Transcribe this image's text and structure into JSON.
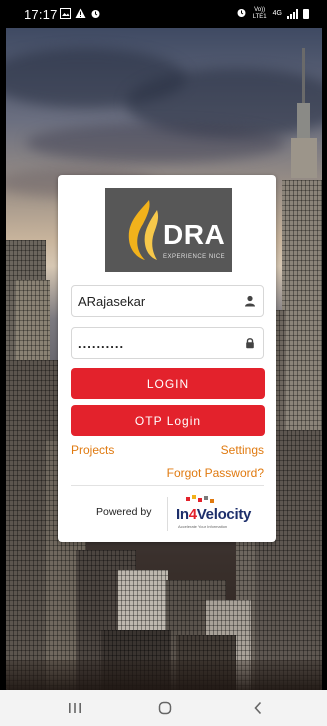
{
  "status_bar": {
    "time": "17:17",
    "left_icons": [
      "gallery-icon",
      "warning-icon",
      "alarm-icon"
    ],
    "right_icons": [
      "alarm-icon",
      "volte-icon",
      "4g-icon",
      "signal-icon",
      "battery-icon"
    ],
    "volte_label": "Vo)) LTE1",
    "network_label": "4G"
  },
  "card": {
    "logo": {
      "brand": "DRA",
      "tagline": "EXPERIENCE NICE"
    },
    "username": {
      "value": "ARajasekar",
      "icon": "user-icon"
    },
    "password": {
      "value": "..........",
      "icon": "lock-icon"
    },
    "login_label": "LOGIN",
    "otp_label": "OTP Login",
    "projects_label": "Projects",
    "settings_label": "Settings",
    "forgot_label": "Forgot Password?",
    "powered_by_label": "Powered by",
    "vendor": {
      "name_prefix": "In",
      "name_digit": "4",
      "name_suffix": "Velocity",
      "tagline": "Accelerate Your Information"
    }
  },
  "colors": {
    "accent": "#e3222c",
    "link": "#e07a10",
    "logo_bg": "#575757",
    "flame": "#f2b21b"
  },
  "nav": {
    "icons": [
      "recent-apps-icon",
      "home-icon",
      "back-icon"
    ]
  }
}
